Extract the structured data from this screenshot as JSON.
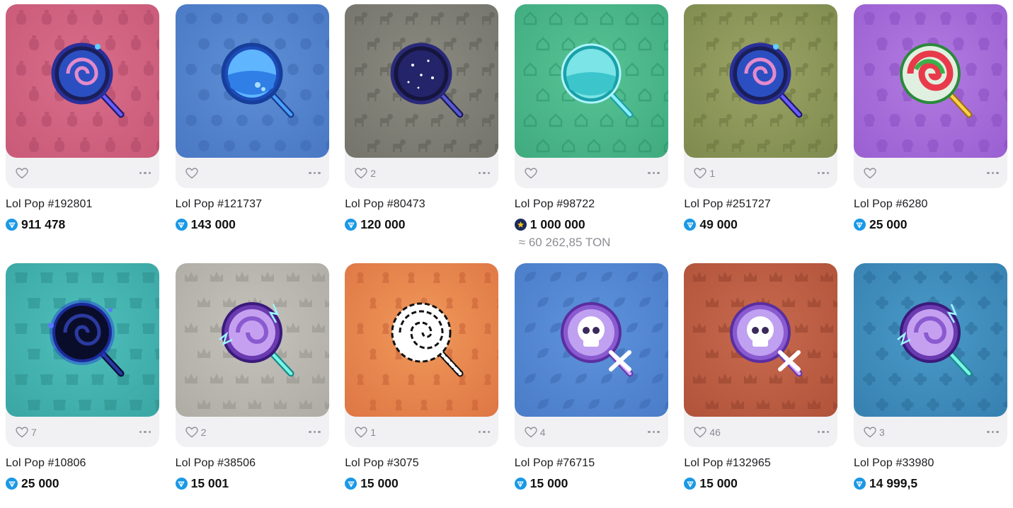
{
  "items": [
    {
      "title": "Lol Pop #192801",
      "likes": "",
      "price": "911 478",
      "currency": "ton",
      "bg": [
        "#d86d8a",
        "#c95a78"
      ],
      "pattern": "money",
      "pop": "galaxy",
      "tint": "#b04a68"
    },
    {
      "title": "Lol Pop #121737",
      "likes": "",
      "price": "143 000",
      "currency": "ton",
      "bg": [
        "#5d8fd6",
        "#4a78c4"
      ],
      "pattern": "cookie",
      "pop": "water",
      "tint": "#3f6ab3"
    },
    {
      "title": "Lol Pop #80473",
      "likes": "2",
      "price": "120 000",
      "currency": "ton",
      "bg": [
        "#8a8a80",
        "#74746c"
      ],
      "pattern": "dog",
      "pop": "night",
      "tint": "#5e5e56"
    },
    {
      "title": "Lol Pop #98722",
      "likes": "",
      "price": "1 000 000",
      "currency": "star",
      "approx": "≈ 60 262,85 TON",
      "bg": [
        "#58c596",
        "#3faa7e"
      ],
      "pattern": "house",
      "pop": "aqua",
      "tint": "#2f936a"
    },
    {
      "title": "Lol Pop #251727",
      "likes": "1",
      "price": "49 000",
      "currency": "ton",
      "bg": [
        "#9ca466",
        "#7e8a4e"
      ],
      "pattern": "dog",
      "pop": "galaxy",
      "tint": "#6c7640"
    },
    {
      "title": "Lol Pop #6280",
      "likes": "",
      "price": "25 000",
      "currency": "ton",
      "bg": [
        "#b27be0",
        "#9a5fd2"
      ],
      "pattern": "cupcake",
      "pop": "candy",
      "tint": "#8a4fc2"
    },
    {
      "title": "Lol Pop #10806",
      "likes": "7",
      "price": "25 000",
      "currency": "ton",
      "bg": [
        "#4fc0bc",
        "#3aa6a4"
      ],
      "pattern": "gift",
      "pop": "dark",
      "tint": "#2f908e"
    },
    {
      "title": "Lol Pop #38506",
      "likes": "2",
      "price": "15 001",
      "currency": "ton",
      "bg": [
        "#c4c2bb",
        "#aeaca4"
      ],
      "pattern": "crown",
      "pop": "electric",
      "tint": "#96948c"
    },
    {
      "title": "Lol Pop #3075",
      "likes": "1",
      "price": "15 000",
      "currency": "ton",
      "bg": [
        "#f0995a",
        "#de7644"
      ],
      "pattern": "keyhole",
      "pop": "spiral",
      "tint": "#c86238"
    },
    {
      "title": "Lol Pop #76715",
      "likes": "4",
      "price": "15 000",
      "currency": "ton",
      "bg": [
        "#5e93dc",
        "#4a7cc8"
      ],
      "pattern": "leaf",
      "pop": "skull",
      "tint": "#3e6bb2"
    },
    {
      "title": "Lol Pop #132965",
      "likes": "46",
      "price": "15 000",
      "currency": "ton",
      "bg": [
        "#c86a4e",
        "#b0533a"
      ],
      "pattern": "crown",
      "pop": "skull",
      "tint": "#96432e"
    },
    {
      "title": "Lol Pop #33980",
      "likes": "3",
      "price": "14 999,5",
      "currency": "ton",
      "bg": [
        "#4a9ac8",
        "#3680b0"
      ],
      "pattern": "flower",
      "pop": "electric",
      "tint": "#2c6e9c"
    }
  ]
}
